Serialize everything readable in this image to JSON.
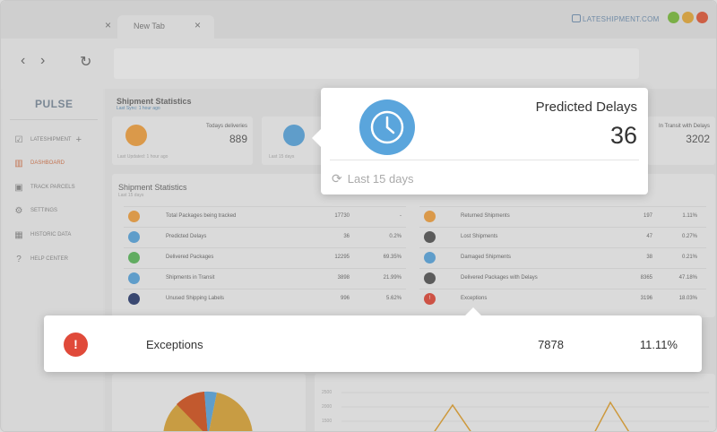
{
  "browser": {
    "tabs": [
      {
        "label": "",
        "close": "×"
      },
      {
        "label": "New Tab",
        "close": "×"
      }
    ],
    "brand": "LATESHIPMENT.COM",
    "nav": {
      "back": "‹",
      "forward": "›",
      "reload": "↻"
    },
    "url": ""
  },
  "sidebar": {
    "logo": "PULSE",
    "items": [
      {
        "label": "LATESHIPMENT",
        "icon": "checkbox-icon",
        "extra": "+"
      },
      {
        "label": "DASHBOARD",
        "icon": "chart-icon",
        "active": true
      },
      {
        "label": "TRACK PARCELS",
        "icon": "parcel-icon"
      },
      {
        "label": "SETTINGS",
        "icon": "gear-icon"
      },
      {
        "label": "HISTORIC DATA",
        "icon": "calendar-icon"
      },
      {
        "label": "HELP CENTER",
        "icon": "question-icon"
      }
    ]
  },
  "header": {
    "title": "Shipment Statistics",
    "last_sync": "Last Sync: 1 hour ago"
  },
  "cards": [
    {
      "label": "Todays deliveries",
      "value": "889",
      "foot": "Last Updated: 1 hour ago",
      "color": "#f0a040"
    },
    {
      "label": "",
      "value": "",
      "foot": "Last 15 days",
      "color": "#5aa5dc"
    },
    {
      "label": "In Transit with Delays",
      "value": "3202",
      "foot": ""
    }
  ],
  "stats": {
    "title": "Shipment Statistics",
    "subtitle": "Last 15 days",
    "left_rows": [
      {
        "label": "Total Packages being tracked",
        "count": "17730",
        "pct": "-",
        "color": "#f0a040"
      },
      {
        "label": "Predicted Delays",
        "count": "36",
        "pct": "0.2%",
        "color": "#5aa5dc"
      },
      {
        "label": "Delivered Packages",
        "count": "12295",
        "pct": "69.35%",
        "color": "#5cb85c"
      },
      {
        "label": "Shipments in Transit",
        "count": "3898",
        "pct": "21.99%",
        "color": "#5aa5dc"
      },
      {
        "label": "Unused Shipping Labels",
        "count": "996",
        "pct": "5.62%",
        "color": "#2c3e70"
      }
    ],
    "right_rows": [
      {
        "label": "Returned Shipments",
        "count": "197",
        "pct": "1.11%",
        "color": "#f0a040"
      },
      {
        "label": "Lost Shipments",
        "count": "47",
        "pct": "0.27%",
        "color": "#555"
      },
      {
        "label": "Damaged Shipments",
        "count": "38",
        "pct": "0.21%",
        "color": "#5aa5dc"
      },
      {
        "label": "Delivered Packages with Delays",
        "count": "8365",
        "pct": "47.18%",
        "color": "#555"
      },
      {
        "label": "Exceptions",
        "count": "3196",
        "pct": "18.03%",
        "color": "#e04a3a"
      }
    ]
  },
  "chart_ticks": [
    "2500",
    "2000",
    "1500"
  ],
  "callout_delays": {
    "title": "Predicted Delays",
    "value": "36",
    "foot": "Last 15 days"
  },
  "callout_exceptions": {
    "label": "Exceptions",
    "count": "7878",
    "pct": "11.11%"
  }
}
